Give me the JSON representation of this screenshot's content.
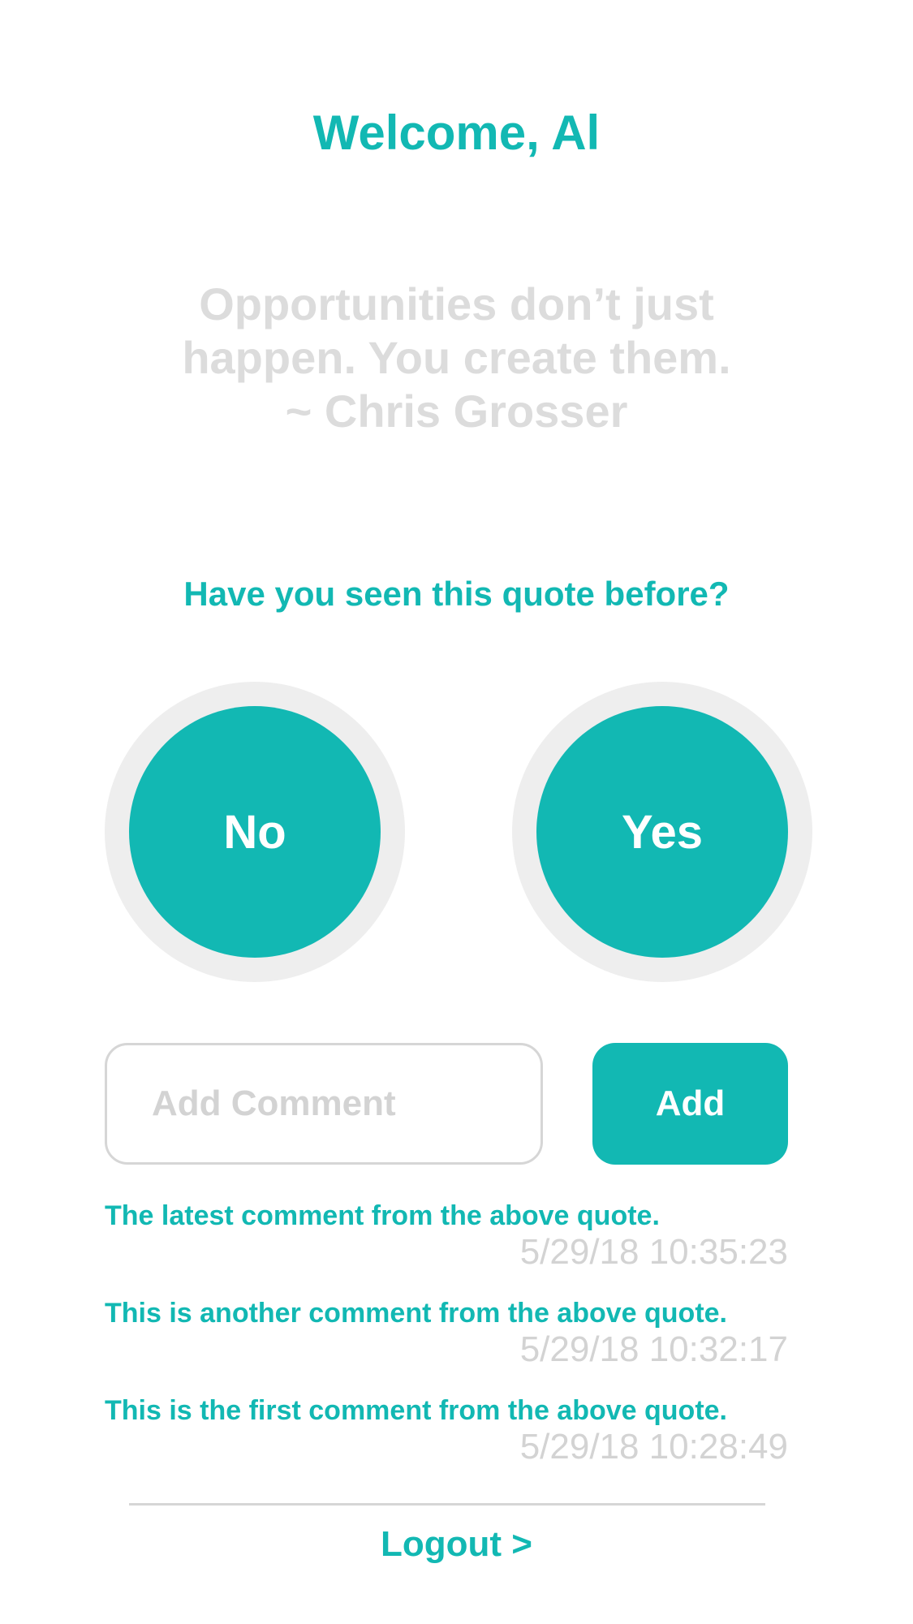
{
  "header": {
    "welcome": "Welcome, Al"
  },
  "quote": {
    "lines": [
      "Opportunities don’t just",
      "happen. You create them.",
      "~ Chris Grosser"
    ]
  },
  "question": "Have you seen this quote before?",
  "choices": {
    "no_label": "No",
    "yes_label": "Yes"
  },
  "comment_form": {
    "placeholder": "Add Comment",
    "value": "",
    "add_label": "Add"
  },
  "comments": [
    {
      "text": "The latest comment from the above quote.",
      "time": "5/29/18 10:35:23"
    },
    {
      "text": "This is another comment from the above quote.",
      "time": "5/29/18 10:32:17"
    },
    {
      "text": "This is the first comment from the above quote.",
      "time": "5/29/18 10:28:49"
    }
  ],
  "footer": {
    "logout_label": "Logout >"
  },
  "colors": {
    "accent": "#12b8b3",
    "muted_text": "#d3d3d3",
    "ring": "#eeeeee"
  }
}
